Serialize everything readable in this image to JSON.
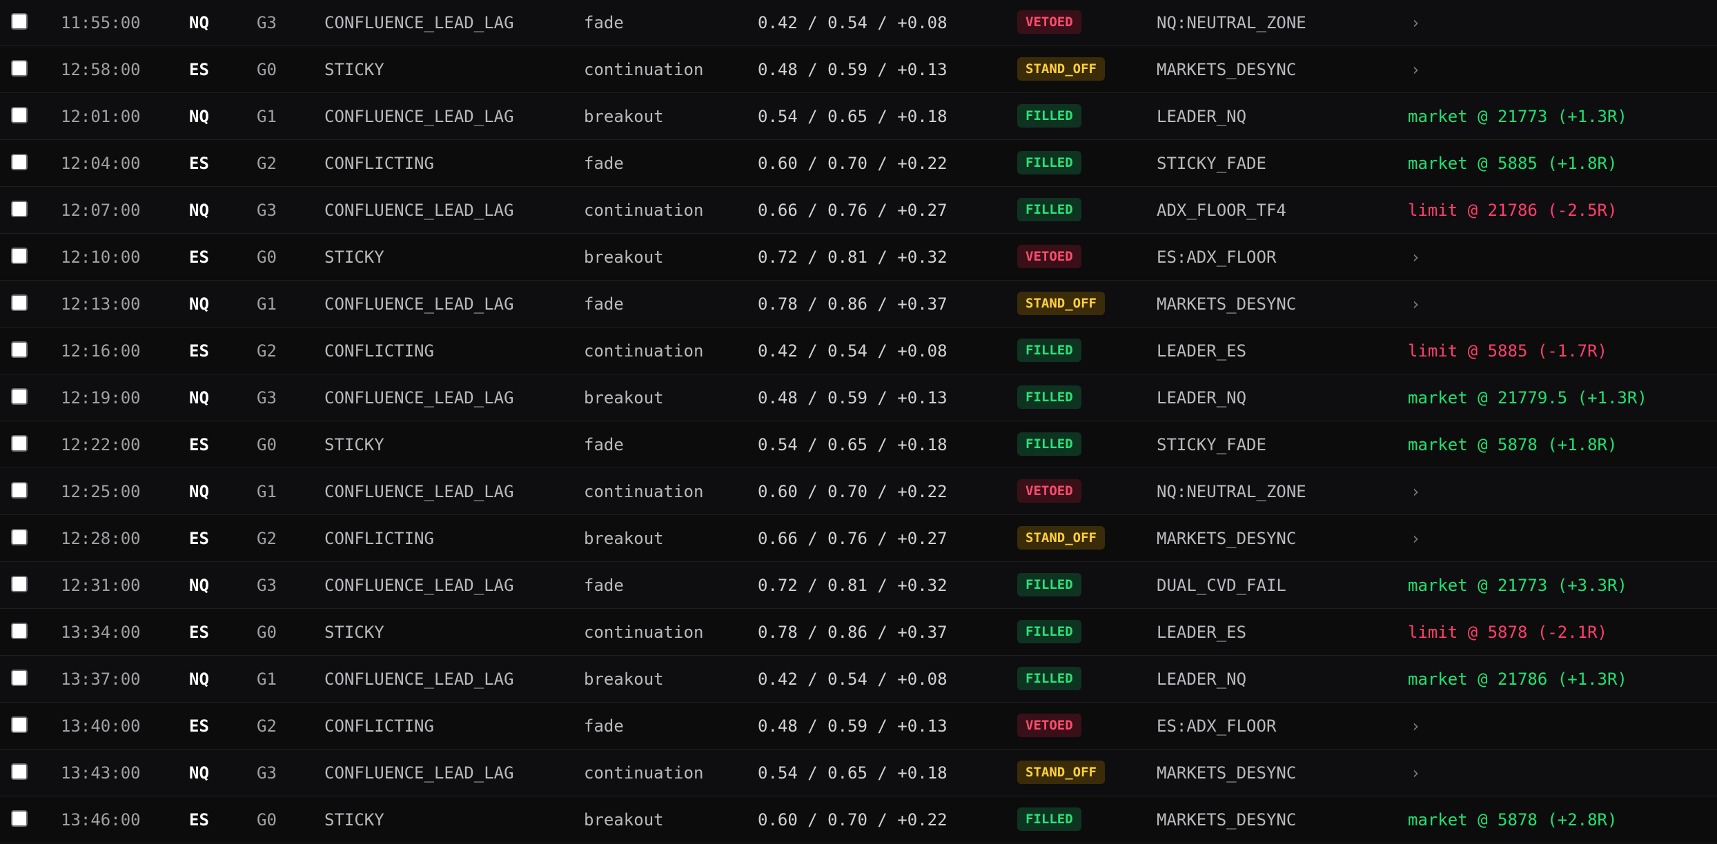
{
  "icons": {
    "expand": "chevron-right-icon",
    "chevron_glyph": "›"
  },
  "colors": {
    "background": "#0b0b0c",
    "vetoed": "#ff4c6f",
    "stand_off": "#ffcf3d",
    "filled": "#2be277",
    "profit": "#22e070",
    "loss": "#ff3f6a"
  },
  "rows": [
    {
      "time": "11:55:00",
      "symbol": "NQ",
      "group": "G3",
      "strategy": "CONFLUENCE_LEAD_LAG",
      "mode": "fade",
      "scores": "0.42 / 0.54 / +0.08",
      "status": "VETOED",
      "reason": "NQ:NEUTRAL_ZONE",
      "result": "",
      "result_type": "none"
    },
    {
      "time": "12:58:00",
      "symbol": "ES",
      "group": "G0",
      "strategy": "STICKY",
      "mode": "continuation",
      "scores": "0.48 / 0.59 / +0.13",
      "status": "STAND_OFF",
      "reason": "MARKETS_DESYNC",
      "result": "",
      "result_type": "none"
    },
    {
      "time": "12:01:00",
      "symbol": "NQ",
      "group": "G1",
      "strategy": "CONFLUENCE_LEAD_LAG",
      "mode": "breakout",
      "scores": "0.54 / 0.65 / +0.18",
      "status": "FILLED",
      "reason": "LEADER_NQ",
      "result": "market @ 21773 (+1.3R)",
      "result_type": "pos"
    },
    {
      "time": "12:04:00",
      "symbol": "ES",
      "group": "G2",
      "strategy": "CONFLICTING",
      "mode": "fade",
      "scores": "0.60 / 0.70 / +0.22",
      "status": "FILLED",
      "reason": "STICKY_FADE",
      "result": "market @ 5885 (+1.8R)",
      "result_type": "pos"
    },
    {
      "time": "12:07:00",
      "symbol": "NQ",
      "group": "G3",
      "strategy": "CONFLUENCE_LEAD_LAG",
      "mode": "continuation",
      "scores": "0.66 / 0.76 / +0.27",
      "status": "FILLED",
      "reason": "ADX_FLOOR_TF4",
      "result": "limit @ 21786 (-2.5R)",
      "result_type": "neg"
    },
    {
      "time": "12:10:00",
      "symbol": "ES",
      "group": "G0",
      "strategy": "STICKY",
      "mode": "breakout",
      "scores": "0.72 / 0.81 / +0.32",
      "status": "VETOED",
      "reason": "ES:ADX_FLOOR",
      "result": "",
      "result_type": "none"
    },
    {
      "time": "12:13:00",
      "symbol": "NQ",
      "group": "G1",
      "strategy": "CONFLUENCE_LEAD_LAG",
      "mode": "fade",
      "scores": "0.78 / 0.86 / +0.37",
      "status": "STAND_OFF",
      "reason": "MARKETS_DESYNC",
      "result": "",
      "result_type": "none"
    },
    {
      "time": "12:16:00",
      "symbol": "ES",
      "group": "G2",
      "strategy": "CONFLICTING",
      "mode": "continuation",
      "scores": "0.42 / 0.54 / +0.08",
      "status": "FILLED",
      "reason": "LEADER_ES",
      "result": "limit @ 5885 (-1.7R)",
      "result_type": "neg"
    },
    {
      "time": "12:19:00",
      "symbol": "NQ",
      "group": "G3",
      "strategy": "CONFLUENCE_LEAD_LAG",
      "mode": "breakout",
      "scores": "0.48 / 0.59 / +0.13",
      "status": "FILLED",
      "reason": "LEADER_NQ",
      "result": "market @ 21779.5 (+1.3R)",
      "result_type": "pos"
    },
    {
      "time": "12:22:00",
      "symbol": "ES",
      "group": "G0",
      "strategy": "STICKY",
      "mode": "fade",
      "scores": "0.54 / 0.65 / +0.18",
      "status": "FILLED",
      "reason": "STICKY_FADE",
      "result": "market @ 5878 (+1.8R)",
      "result_type": "pos"
    },
    {
      "time": "12:25:00",
      "symbol": "NQ",
      "group": "G1",
      "strategy": "CONFLUENCE_LEAD_LAG",
      "mode": "continuation",
      "scores": "0.60 / 0.70 / +0.22",
      "status": "VETOED",
      "reason": "NQ:NEUTRAL_ZONE",
      "result": "",
      "result_type": "none"
    },
    {
      "time": "12:28:00",
      "symbol": "ES",
      "group": "G2",
      "strategy": "CONFLICTING",
      "mode": "breakout",
      "scores": "0.66 / 0.76 / +0.27",
      "status": "STAND_OFF",
      "reason": "MARKETS_DESYNC",
      "result": "",
      "result_type": "none"
    },
    {
      "time": "12:31:00",
      "symbol": "NQ",
      "group": "G3",
      "strategy": "CONFLUENCE_LEAD_LAG",
      "mode": "fade",
      "scores": "0.72 / 0.81 / +0.32",
      "status": "FILLED",
      "reason": "DUAL_CVD_FAIL",
      "result": "market @ 21773 (+3.3R)",
      "result_type": "pos"
    },
    {
      "time": "13:34:00",
      "symbol": "ES",
      "group": "G0",
      "strategy": "STICKY",
      "mode": "continuation",
      "scores": "0.78 / 0.86 / +0.37",
      "status": "FILLED",
      "reason": "LEADER_ES",
      "result": "limit @ 5878 (-2.1R)",
      "result_type": "neg"
    },
    {
      "time": "13:37:00",
      "symbol": "NQ",
      "group": "G1",
      "strategy": "CONFLUENCE_LEAD_LAG",
      "mode": "breakout",
      "scores": "0.42 / 0.54 / +0.08",
      "status": "FILLED",
      "reason": "LEADER_NQ",
      "result": "market @ 21786 (+1.3R)",
      "result_type": "pos"
    },
    {
      "time": "13:40:00",
      "symbol": "ES",
      "group": "G2",
      "strategy": "CONFLICTING",
      "mode": "fade",
      "scores": "0.48 / 0.59 / +0.13",
      "status": "VETOED",
      "reason": "ES:ADX_FLOOR",
      "result": "",
      "result_type": "none"
    },
    {
      "time": "13:43:00",
      "symbol": "NQ",
      "group": "G3",
      "strategy": "CONFLUENCE_LEAD_LAG",
      "mode": "continuation",
      "scores": "0.54 / 0.65 / +0.18",
      "status": "STAND_OFF",
      "reason": "MARKETS_DESYNC",
      "result": "",
      "result_type": "none"
    },
    {
      "time": "13:46:00",
      "symbol": "ES",
      "group": "G0",
      "strategy": "STICKY",
      "mode": "breakout",
      "scores": "0.60 / 0.70 / +0.22",
      "status": "FILLED",
      "reason": "MARKETS_DESYNC",
      "result": "market @ 5878 (+2.8R)",
      "result_type": "pos"
    }
  ]
}
